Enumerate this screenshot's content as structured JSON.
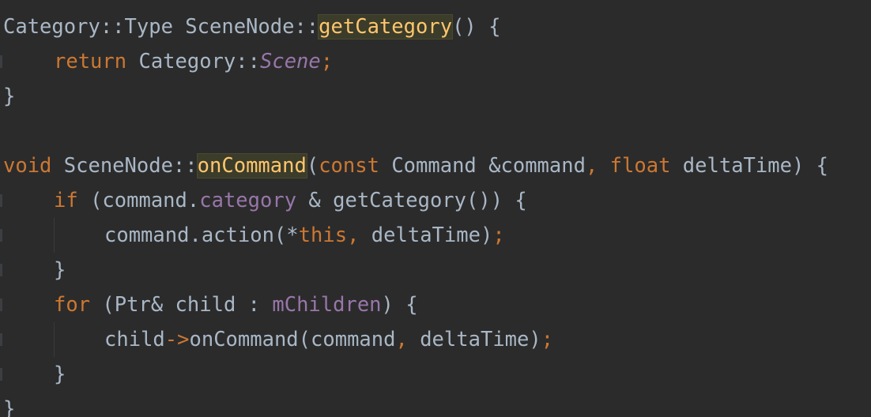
{
  "lines": [
    {
      "tokens": [
        {
          "t": "Category::Type SceneNode::",
          "c": "typ"
        },
        {
          "t": "getCategory",
          "c": "fn",
          "hl": true
        },
        {
          "t": "() {",
          "c": "punct"
        }
      ]
    },
    {
      "indent": 1,
      "tokens": [
        {
          "t": "return ",
          "c": "kw"
        },
        {
          "t": "Category::",
          "c": "typ"
        },
        {
          "t": "Scene",
          "c": "enumc"
        },
        {
          "t": ";",
          "c": "semi"
        }
      ]
    },
    {
      "tokens": [
        {
          "t": "}",
          "c": "punct"
        }
      ]
    },
    {
      "tokens": []
    },
    {
      "tokens": [
        {
          "t": "void ",
          "c": "kw"
        },
        {
          "t": "SceneNode::",
          "c": "typ"
        },
        {
          "t": "onCommand",
          "c": "fn",
          "hl": true
        },
        {
          "t": "(",
          "c": "punct"
        },
        {
          "t": "const ",
          "c": "kw"
        },
        {
          "t": "Command &command",
          "c": "typ"
        },
        {
          "t": ", ",
          "c": "semi"
        },
        {
          "t": "float ",
          "c": "kw"
        },
        {
          "t": "deltaTime) {",
          "c": "typ"
        }
      ]
    },
    {
      "indent": 1,
      "tokens": [
        {
          "t": "if ",
          "c": "kw"
        },
        {
          "t": "(command.",
          "c": "typ"
        },
        {
          "t": "category",
          "c": "field"
        },
        {
          "t": " & getCategory()) {",
          "c": "typ"
        }
      ]
    },
    {
      "indent": 2,
      "tokens": [
        {
          "t": "command.action(*",
          "c": "typ"
        },
        {
          "t": "this",
          "c": "kw"
        },
        {
          "t": ", ",
          "c": "semi"
        },
        {
          "t": "deltaTime)",
          "c": "typ"
        },
        {
          "t": ";",
          "c": "semi"
        }
      ]
    },
    {
      "indent": 1,
      "tokens": [
        {
          "t": "}",
          "c": "punct"
        }
      ]
    },
    {
      "indent": 1,
      "tokens": [
        {
          "t": "for ",
          "c": "kw"
        },
        {
          "t": "(Ptr& child : ",
          "c": "typ"
        },
        {
          "t": "mChildren",
          "c": "field"
        },
        {
          "t": ") {",
          "c": "typ"
        }
      ]
    },
    {
      "indent": 2,
      "tokens": [
        {
          "t": "child",
          "c": "typ"
        },
        {
          "t": "->",
          "c": "arrow"
        },
        {
          "t": "onCommand(command",
          "c": "typ"
        },
        {
          "t": ", ",
          "c": "semi"
        },
        {
          "t": "deltaTime)",
          "c": "typ"
        },
        {
          "t": ";",
          "c": "semi"
        }
      ]
    },
    {
      "indent": 1,
      "tokens": [
        {
          "t": "}",
          "c": "punct"
        }
      ]
    },
    {
      "tokens": [
        {
          "t": "}",
          "c": "punct"
        }
      ]
    }
  ]
}
